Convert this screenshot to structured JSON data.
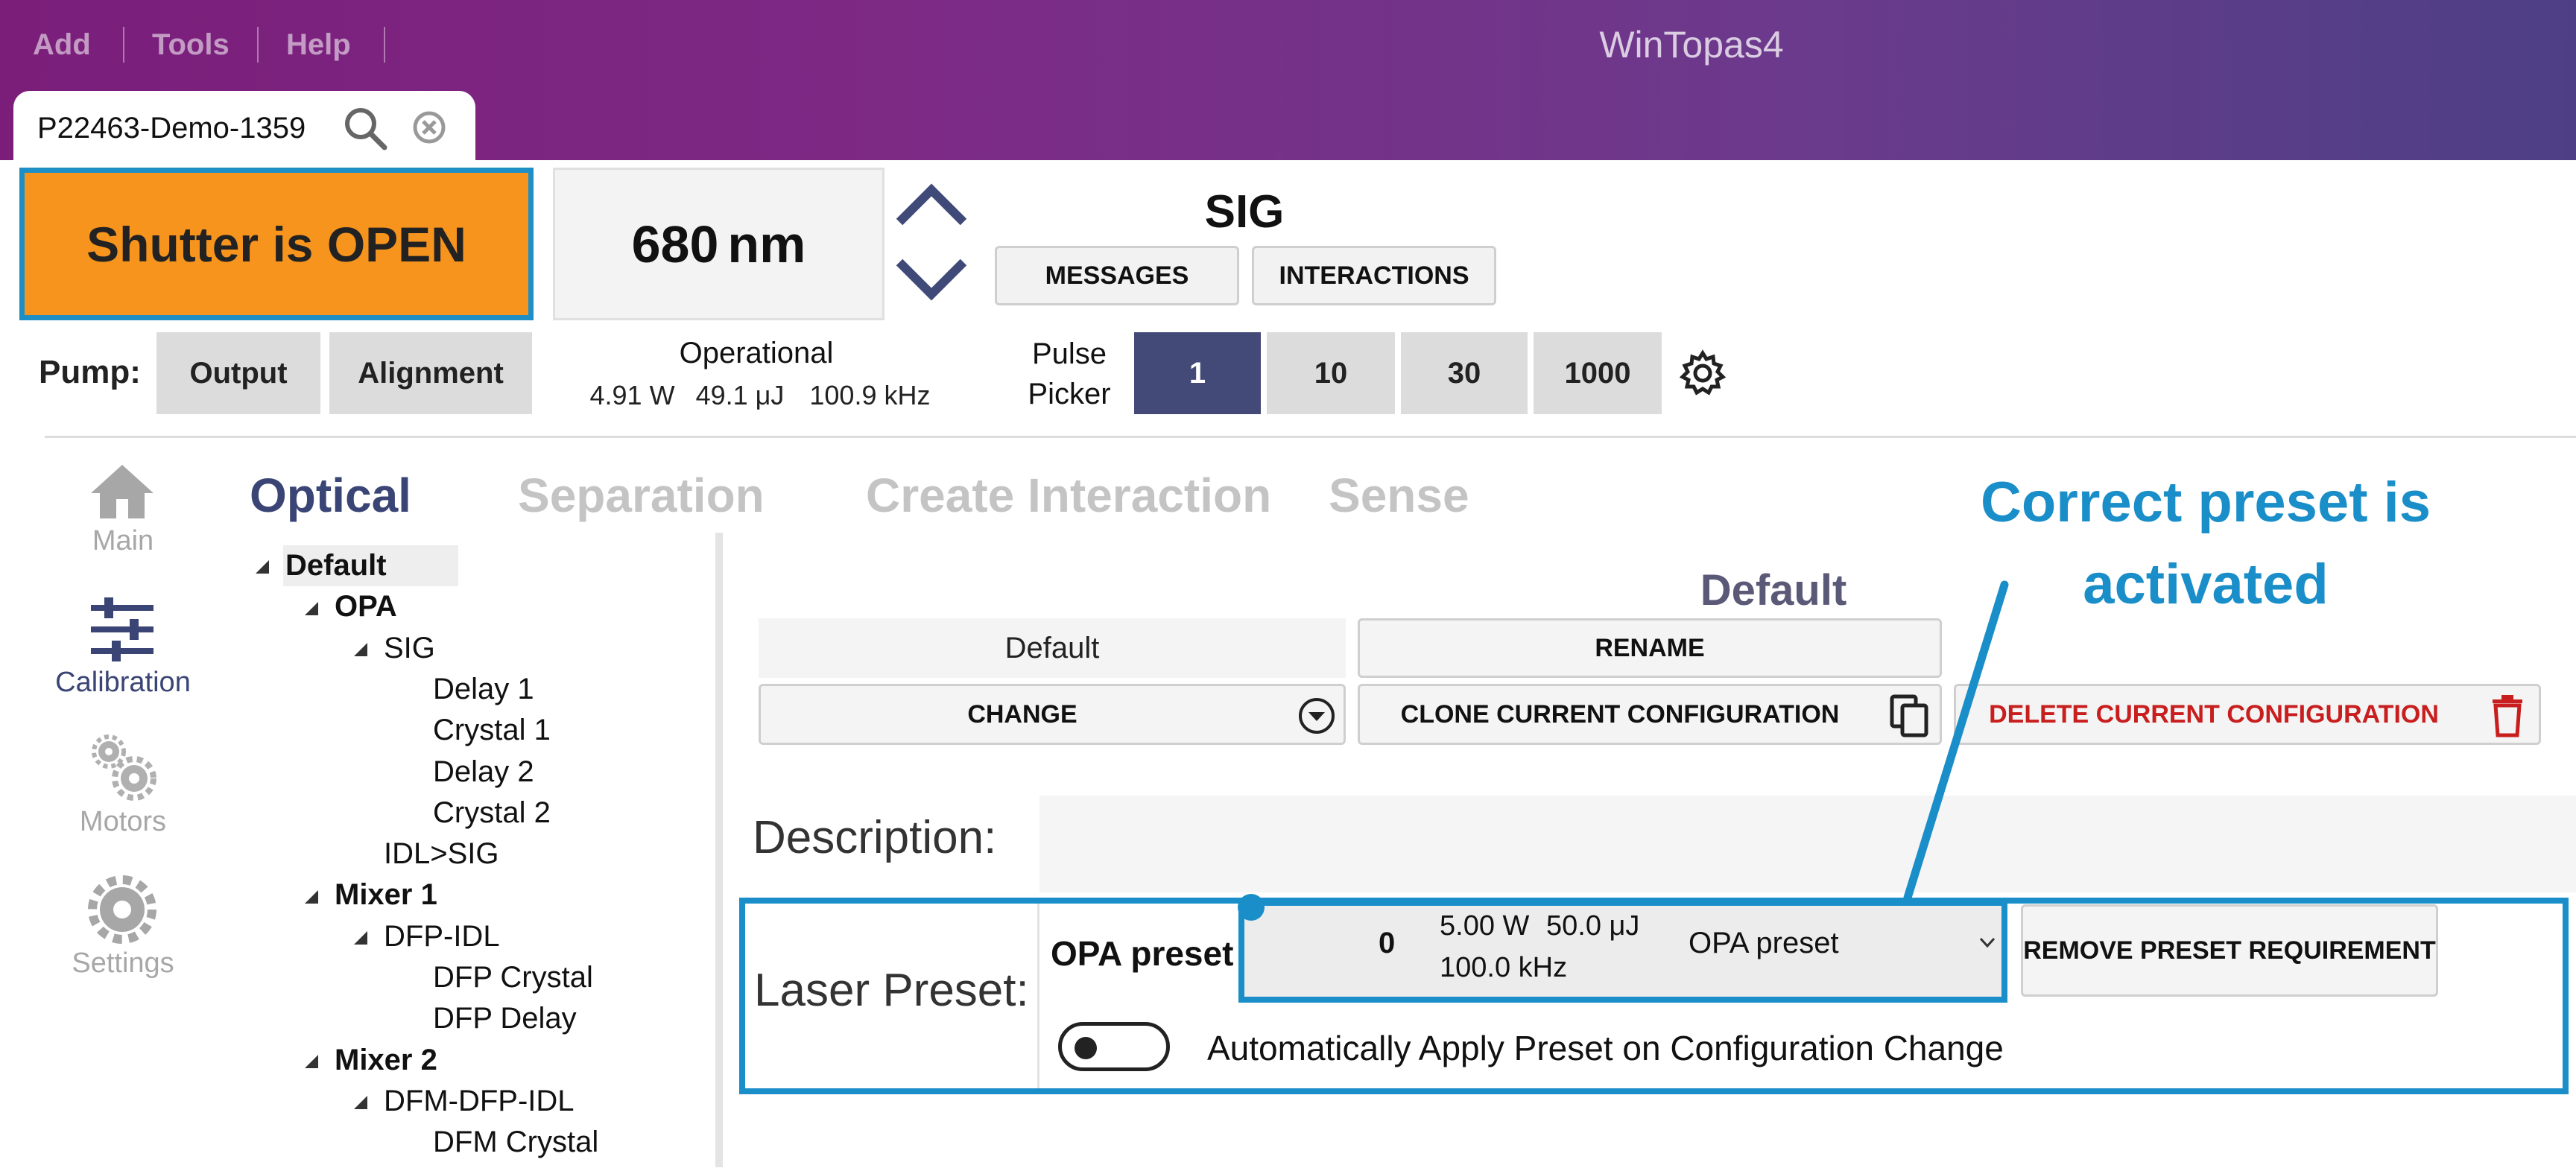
{
  "menu": {
    "add": "Add",
    "tools": "Tools",
    "help": "Help"
  },
  "app_title": "WinTopas4",
  "tab": {
    "title": "P22463-Demo-1359"
  },
  "header": {
    "shutter_status": "Shutter is OPEN",
    "wavelength_value": "680",
    "wavelength_unit": "nm",
    "interaction_name": "SIG",
    "messages_label": "MESSAGES",
    "interactions_label": "INTERACTIONS"
  },
  "pump": {
    "label": "Pump:",
    "output_label": "Output",
    "alignment_label": "Alignment",
    "operational_title": "Operational",
    "power": "4.91 W",
    "energy": "49.1 μJ",
    "frequency": "100.9 kHz"
  },
  "pulse_picker": {
    "label_line1": "Pulse",
    "label_line2": "Picker",
    "options": [
      "1",
      "10",
      "30",
      "1000"
    ],
    "selected": "1"
  },
  "sidebar": {
    "items": [
      {
        "label": "Main",
        "icon": "home-icon"
      },
      {
        "label": "Calibration",
        "icon": "sliders-icon"
      },
      {
        "label": "Motors",
        "icon": "gears-icon"
      },
      {
        "label": "Settings",
        "icon": "gear-icon"
      }
    ],
    "active": "Calibration"
  },
  "main_tabs": [
    "Optical",
    "Separation",
    "Create Interaction",
    "Sense"
  ],
  "active_tab": "Optical",
  "tree": [
    {
      "label": "Default",
      "level": 0,
      "expanded": true,
      "bold": true
    },
    {
      "label": "OPA",
      "level": 1,
      "expanded": true
    },
    {
      "label": "SIG",
      "level": 2,
      "expanded": true
    },
    {
      "label": "Delay 1",
      "level": 3
    },
    {
      "label": "Crystal 1",
      "level": 3
    },
    {
      "label": "Delay 2",
      "level": 3
    },
    {
      "label": "Crystal 2",
      "level": 3
    },
    {
      "label": "IDL>SIG",
      "level": 2
    },
    {
      "label": "Mixer 1",
      "level": 1,
      "expanded": true
    },
    {
      "label": "DFP-IDL",
      "level": 2,
      "expanded": true
    },
    {
      "label": "DFP Crystal",
      "level": 3
    },
    {
      "label": "DFP Delay",
      "level": 3
    },
    {
      "label": "Mixer 2",
      "level": 1,
      "expanded": true
    },
    {
      "label": "DFM-DFP-IDL",
      "level": 2,
      "expanded": true
    },
    {
      "label": "DFM Crystal",
      "level": 3
    }
  ],
  "config": {
    "heading": "Default",
    "name_field": "Default",
    "rename_label": "RENAME",
    "change_label": "CHANGE",
    "clone_label": "CLONE CURRENT CONFIGURATION",
    "delete_label": "DELETE CURRENT CONFIGURATION",
    "description_label": "Description:",
    "description_value": ""
  },
  "laser_preset": {
    "label": "Laser Preset:",
    "preset_name_label": "OPA preset",
    "dropdown": {
      "index": "0",
      "power": "5.00 W",
      "energy": "50.0 μJ",
      "frequency": "100.0 kHz",
      "name": "OPA preset"
    },
    "remove_label": "REMOVE PRESET REQUIREMENT",
    "auto_apply_label": "Automatically Apply Preset on Configuration Change",
    "auto_apply_enabled": false
  },
  "annotation": {
    "line1": "Correct preset is",
    "line2": "activated"
  },
  "colors": {
    "accent_blue": "#1a8ec8",
    "shutter_orange": "#f7941d",
    "active_navy": "#434a78",
    "delete_red": "#c81e1e"
  }
}
